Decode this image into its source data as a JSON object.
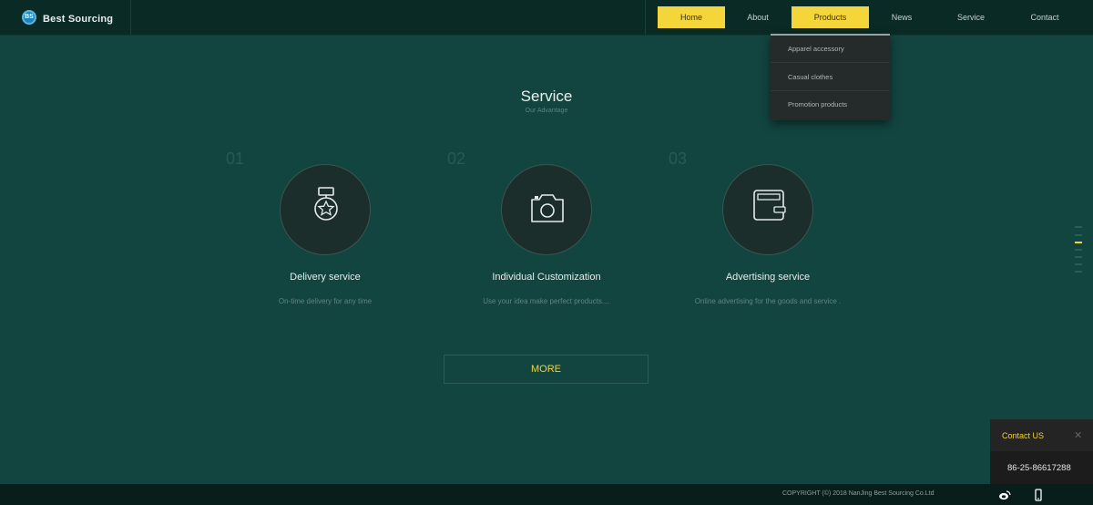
{
  "brand": {
    "logo_mark": "BS",
    "name": "Best Sourcing"
  },
  "nav": [
    {
      "label": "Home",
      "active": true
    },
    {
      "label": "About",
      "active": false
    },
    {
      "label": "Products",
      "active": true
    },
    {
      "label": "News",
      "active": false
    },
    {
      "label": "Service",
      "active": false
    },
    {
      "label": "Contact",
      "active": false
    }
  ],
  "dropdown": {
    "items": [
      "Apparel accessory",
      "Casual clothes",
      "Promotion products"
    ]
  },
  "section": {
    "title": "Service",
    "subtitle": "Our Advantage"
  },
  "cards": [
    {
      "number": "01",
      "icon": "medal-icon",
      "title": "Delivery service",
      "desc": "On-time delivery for any time"
    },
    {
      "number": "02",
      "icon": "camera-icon",
      "title": "Individual Customization",
      "desc": "Use your idea make perfect products...."
    },
    {
      "number": "03",
      "icon": "wallet-icon",
      "title": "Advertising service",
      "desc": "Online advertising for the goods and service ."
    }
  ],
  "more_button": "MORE",
  "side_nav": {
    "count": 7,
    "active_index": 2
  },
  "contact": {
    "title": "Contact US",
    "close_icon": "close-icon",
    "phone": "86-25-86617288"
  },
  "footer": {
    "copyright": "COPYRIGHT (©) 2018 NanJing Best Sourcing Co.Ltd",
    "icons": [
      "weibo-icon",
      "mobile-icon"
    ]
  },
  "colors": {
    "accent": "#f5d63a",
    "background": "#124540",
    "header": "#0a2a26"
  }
}
